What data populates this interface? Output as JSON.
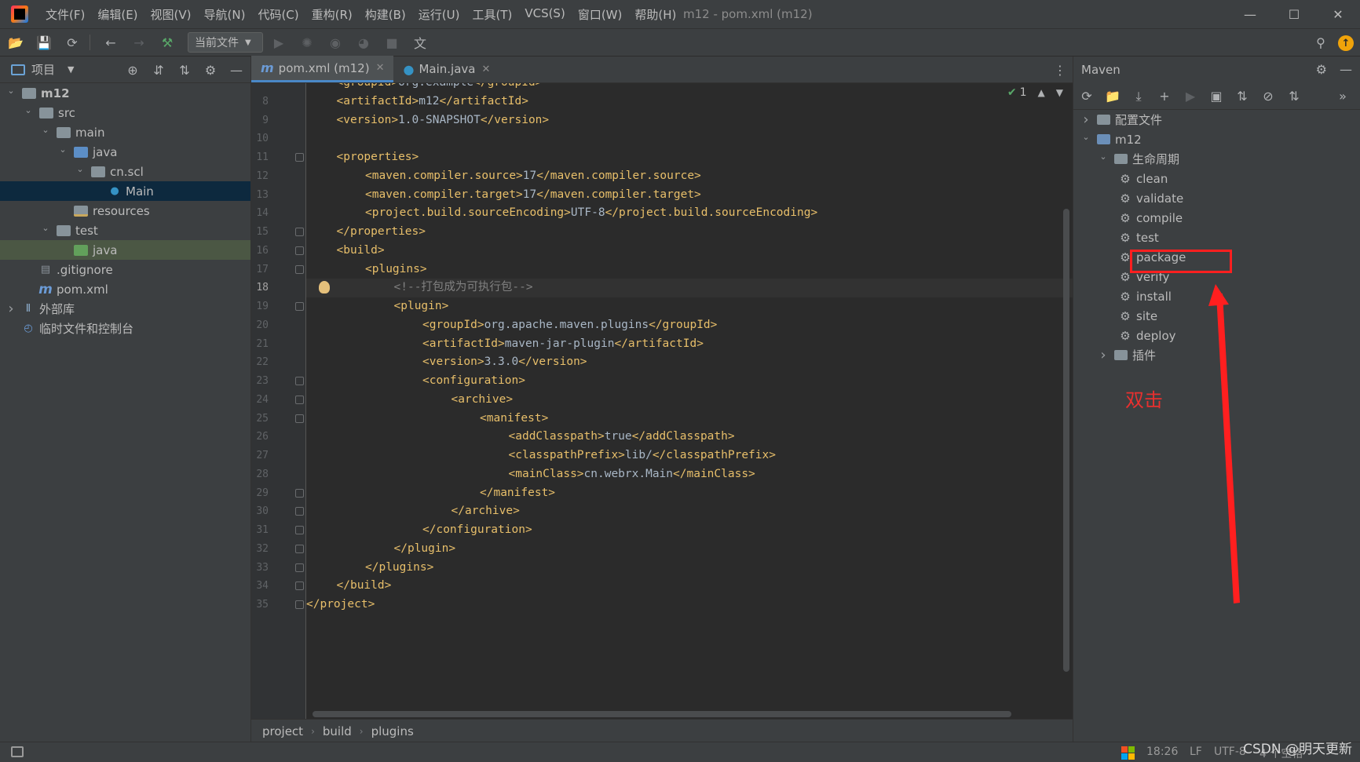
{
  "window": {
    "title": "m12 - pom.xml (m12)",
    "minimize": "—",
    "maximize": "☐",
    "close": "✕"
  },
  "menu": [
    "文件(F)",
    "编辑(E)",
    "视图(V)",
    "导航(N)",
    "代码(C)",
    "重构(R)",
    "构建(B)",
    "运行(U)",
    "工具(T)",
    "VCS(S)",
    "窗口(W)",
    "帮助(H)"
  ],
  "toolbar": {
    "run_config": "当前文件"
  },
  "project": {
    "title": "项目",
    "tree": [
      {
        "label": "m12",
        "indent": 0,
        "twisty": "v",
        "icon": "module-folder",
        "bold": true
      },
      {
        "label": "src",
        "indent": 1,
        "twisty": "v",
        "icon": "folder"
      },
      {
        "label": "main",
        "indent": 2,
        "twisty": "v",
        "icon": "folder"
      },
      {
        "label": "java",
        "indent": 3,
        "twisty": "v",
        "icon": "source-folder"
      },
      {
        "label": "cn.scl",
        "indent": 4,
        "twisty": "v",
        "icon": "package-folder"
      },
      {
        "label": "Main",
        "indent": 5,
        "twisty": "",
        "icon": "class-main",
        "selected": true
      },
      {
        "label": "resources",
        "indent": 3,
        "twisty": "",
        "icon": "resources-folder"
      },
      {
        "label": "test",
        "indent": 2,
        "twisty": "v",
        "icon": "folder"
      },
      {
        "label": "java",
        "indent": 3,
        "twisty": "",
        "icon": "test-folder",
        "highlight": true
      },
      {
        "label": ".gitignore",
        "indent": 1,
        "twisty": "",
        "icon": "gitignore-file"
      },
      {
        "label": "pom.xml",
        "indent": 1,
        "twisty": "",
        "icon": "maven-file"
      },
      {
        "label": "外部库",
        "indent": 0,
        "twisty": ">",
        "icon": "library"
      },
      {
        "label": "临时文件和控制台",
        "indent": 0,
        "twisty": "",
        "icon": "scratch"
      }
    ]
  },
  "editor": {
    "tabs": [
      {
        "label": "pom.xml (m12)",
        "icon": "m",
        "active": true
      },
      {
        "label": "Main.java",
        "icon": "C",
        "active": false
      }
    ],
    "inspection_count": "1",
    "current_line": 18,
    "lines": [
      {
        "n": "",
        "indent": 1,
        "tag_open": "<groupId>",
        "text": "org.example",
        "tag_close": "</groupId>",
        "partial": true
      },
      {
        "n": "8",
        "indent": 1,
        "tag_open": "<artifactId>",
        "text": "m12",
        "tag_close": "</artifactId>"
      },
      {
        "n": "9",
        "indent": 1,
        "tag_open": "<version>",
        "text": "1.0-SNAPSHOT",
        "tag_close": "</version>"
      },
      {
        "n": "10",
        "indent": 0,
        "tag_open": "",
        "text": "",
        "tag_close": ""
      },
      {
        "n": "11",
        "indent": 1,
        "tag_open": "<properties>",
        "text": "",
        "tag_close": "",
        "fold": true
      },
      {
        "n": "12",
        "indent": 2,
        "tag_open": "<maven.compiler.source>",
        "text": "17",
        "tag_close": "</maven.compiler.source>"
      },
      {
        "n": "13",
        "indent": 2,
        "tag_open": "<maven.compiler.target>",
        "text": "17",
        "tag_close": "</maven.compiler.target>"
      },
      {
        "n": "14",
        "indent": 2,
        "tag_open": "<project.build.sourceEncoding>",
        "text": "UTF-8",
        "tag_close": "</project.build.sourceEncoding>"
      },
      {
        "n": "15",
        "indent": 1,
        "tag_open": "</properties>",
        "text": "",
        "tag_close": "",
        "fold": true
      },
      {
        "n": "16",
        "indent": 1,
        "tag_open": "<build>",
        "text": "",
        "tag_close": "",
        "fold": true
      },
      {
        "n": "17",
        "indent": 2,
        "tag_open": "<plugins>",
        "text": "",
        "tag_close": "",
        "fold": true
      },
      {
        "n": "18",
        "indent": 3,
        "comment": "<!--打包成为可执行包-->"
      },
      {
        "n": "19",
        "indent": 3,
        "tag_open": "<plugin>",
        "text": "",
        "tag_close": "",
        "fold": true
      },
      {
        "n": "20",
        "indent": 4,
        "tag_open": "<groupId>",
        "text": "org.apache.maven.plugins",
        "tag_close": "</groupId>"
      },
      {
        "n": "21",
        "indent": 4,
        "tag_open": "<artifactId>",
        "text": "maven-jar-plugin",
        "tag_close": "</artifactId>"
      },
      {
        "n": "22",
        "indent": 4,
        "tag_open": "<version>",
        "text": "3.3.0",
        "tag_close": "</version>"
      },
      {
        "n": "23",
        "indent": 4,
        "tag_open": "<configuration>",
        "text": "",
        "tag_close": "",
        "fold": true
      },
      {
        "n": "24",
        "indent": 5,
        "tag_open": "<archive>",
        "text": "",
        "tag_close": "",
        "fold": true
      },
      {
        "n": "25",
        "indent": 6,
        "tag_open": "<manifest>",
        "text": "",
        "tag_close": "",
        "fold": true
      },
      {
        "n": "26",
        "indent": 7,
        "tag_open": "<addClasspath>",
        "text": "true",
        "tag_close": "</addClasspath>"
      },
      {
        "n": "27",
        "indent": 7,
        "tag_open": "<classpathPrefix>",
        "text": "lib/",
        "tag_close": "</classpathPrefix>"
      },
      {
        "n": "28",
        "indent": 7,
        "tag_open": "<mainClass>",
        "text": "cn.webrx.Main",
        "tag_close": "</mainClass>"
      },
      {
        "n": "29",
        "indent": 6,
        "tag_open": "</manifest>",
        "text": "",
        "tag_close": "",
        "fold": true
      },
      {
        "n": "30",
        "indent": 5,
        "tag_open": "</archive>",
        "text": "",
        "tag_close": "",
        "fold": true
      },
      {
        "n": "31",
        "indent": 4,
        "tag_open": "</configuration>",
        "text": "",
        "tag_close": "",
        "fold": true
      },
      {
        "n": "32",
        "indent": 3,
        "tag_open": "</plugin>",
        "text": "",
        "tag_close": "",
        "fold": true
      },
      {
        "n": "33",
        "indent": 2,
        "tag_open": "</plugins>",
        "text": "",
        "tag_close": "",
        "fold": true
      },
      {
        "n": "34",
        "indent": 1,
        "tag_open": "</build>",
        "text": "",
        "tag_close": "",
        "fold": true
      },
      {
        "n": "35",
        "indent": 0,
        "tag_open": "</project>",
        "text": "",
        "tag_close": "",
        "fold": true
      }
    ],
    "breadcrumb": [
      "project",
      "build",
      "plugins"
    ]
  },
  "maven": {
    "title": "Maven",
    "tree": [
      {
        "label": "配置文件",
        "indent": 0,
        "twisty": ">",
        "icon": "folder"
      },
      {
        "label": "m12",
        "indent": 0,
        "twisty": "v",
        "icon": "maven-module"
      },
      {
        "label": "生命周期",
        "indent": 1,
        "twisty": "v",
        "icon": "folder"
      },
      {
        "label": "clean",
        "indent": 2,
        "twisty": "",
        "icon": "gear"
      },
      {
        "label": "validate",
        "indent": 2,
        "twisty": "",
        "icon": "gear"
      },
      {
        "label": "compile",
        "indent": 2,
        "twisty": "",
        "icon": "gear"
      },
      {
        "label": "test",
        "indent": 2,
        "twisty": "",
        "icon": "gear"
      },
      {
        "label": "package",
        "indent": 2,
        "twisty": "",
        "icon": "gear",
        "annotated": true
      },
      {
        "label": "verify",
        "indent": 2,
        "twisty": "",
        "icon": "gear"
      },
      {
        "label": "install",
        "indent": 2,
        "twisty": "",
        "icon": "gear"
      },
      {
        "label": "site",
        "indent": 2,
        "twisty": "",
        "icon": "gear"
      },
      {
        "label": "deploy",
        "indent": 2,
        "twisty": "",
        "icon": "gear"
      },
      {
        "label": "插件",
        "indent": 1,
        "twisty": ">",
        "icon": "folder"
      }
    ],
    "annotation": "双击"
  },
  "status": {
    "time": "18:26",
    "line_sep": "LF",
    "encoding": "UTF-8",
    "indent": "4 个空格"
  },
  "watermark": "CSDN @明天更新"
}
